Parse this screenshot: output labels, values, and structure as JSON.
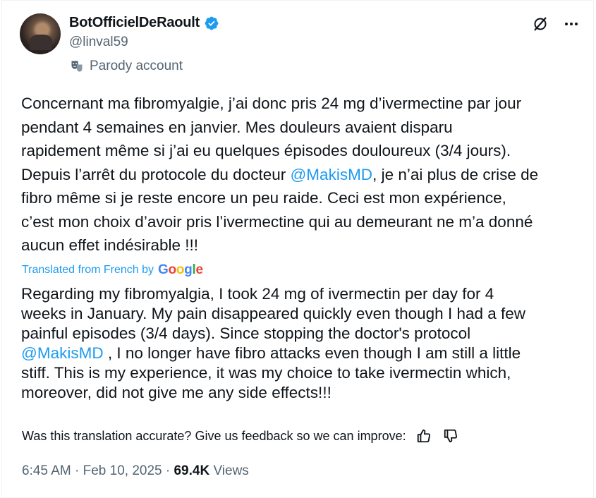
{
  "author": {
    "display_name": "BotOfficielDeRaoult",
    "handle": "@linval59",
    "label": "Parody account"
  },
  "tweet": {
    "text_part1": "Concernant ma fibromyalgie, j’ai donc pris 24 mg d’ivermectine par jour\npendant 4 semaines en janvier. Mes douleurs avaient disparu\nrapidement même si j’ai eu quelques épisodes douloureux (3/4 jours).\nDepuis l’arrêt du protocole du docteur ",
    "mention": "@MakisMD",
    "text_part2": ", je n’ai plus de crise de\nfibro même si je reste encore un peu raide. Ceci est mon expérience,\nc’est mon choix d’avoir pris l’ivermectine qui au demeurant ne m’a donné\naucun effet indésirable !!!"
  },
  "translation": {
    "label": "Translated from French by",
    "provider": "Google",
    "text_part1": "Regarding my fibromyalgia, I took 24 mg of ivermectin per day for 4\nweeks in January. My pain disappeared quickly even though I had a few\npainful episodes (3/4 days). Since stopping the doctor's protocol\n",
    "mention": "@MakisMD",
    "text_part2": " , I no longer have fibro attacks even though I am still a little\nstiff. This is my experience, it was my choice to take ivermectin which,\nmoreover, did not give me any side effects!!!",
    "feedback_prompt": "Was this translation accurate? Give us feedback so we can improve:"
  },
  "meta": {
    "time": "6:45 AM",
    "sep1": " · ",
    "date": "Feb 10, 2025",
    "sep2": " · ",
    "views_count": "69.4K",
    "views_label": " Views"
  },
  "icons": {
    "verified": "verified-badge-icon",
    "parody": "theater-mask-icon",
    "grok": "grok-icon",
    "more": "more-dots-icon",
    "thumbs_up": "thumbs-up-icon",
    "thumbs_down": "thumbs-down-icon"
  },
  "colors": {
    "accent": "#1d9bf0",
    "secondary_text": "#536471",
    "primary_text": "#0f1419"
  }
}
